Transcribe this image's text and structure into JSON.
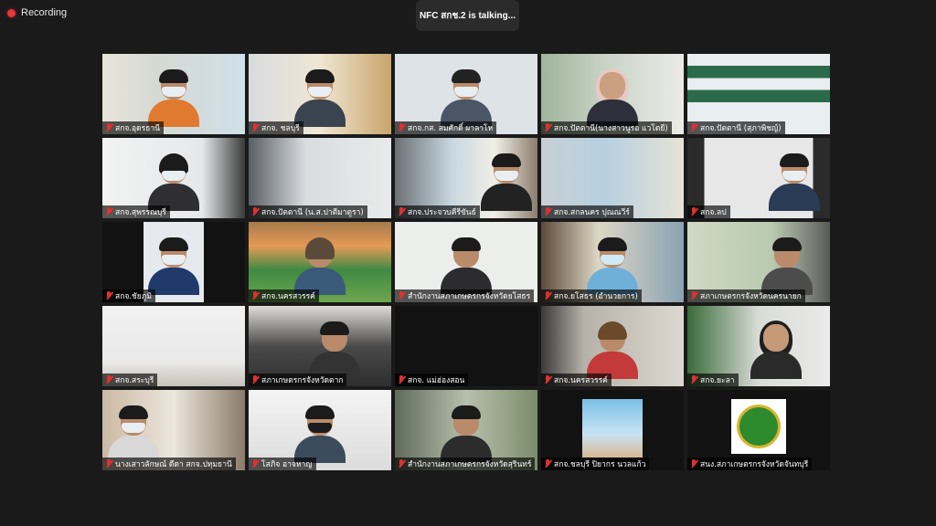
{
  "recording": {
    "label": "Recording"
  },
  "speaker": {
    "text": "NFC สกช.2 is  talking..."
  },
  "colors": {
    "background": "#1a1a1a",
    "muted_mic": "#e0312f",
    "recording_dot": "#e8363a"
  },
  "tiles": [
    {
      "name": "สกจ.อุดรธานี"
    },
    {
      "name": "สกจ. ชลบุรี"
    },
    {
      "name": "สกจ.กส. สมศักดิ์ ผาลาโห"
    },
    {
      "name": "สกจ.ปัตตานี(นางสาวนูรอ  แวโดยี)"
    },
    {
      "name": "สกจ.ปัตตานี (สุภาพิชญ์)"
    },
    {
      "name": "สกจ.สุพรรณบุรี"
    },
    {
      "name": "สกจ.ปัตตานี (น.ส.ปาตีมาตูรา)"
    },
    {
      "name": "สกจ.ประจวบคีรีขันธ์"
    },
    {
      "name": "สกจ.สกลนคร ปุณณวีร์"
    },
    {
      "name": "สกจ.ลป"
    },
    {
      "name": "สกจ.ชัยภูมิ"
    },
    {
      "name": "สกจ.นครสวรรค์"
    },
    {
      "name": "สำนักงานสภาเกษตรกรจังหวัดยโสธร"
    },
    {
      "name": "สกจ.ยโสธร (อำนวยการ)"
    },
    {
      "name": "สภาเกษตรกรจังหวัดนครนายก"
    },
    {
      "name": "สกจ.สระบุรี"
    },
    {
      "name": "สภาเกษตรกรจังหวัดตาก"
    },
    {
      "name": "สกจ. แม่ฮ่องสอน"
    },
    {
      "name": "สกจ.นครสวรรค์"
    },
    {
      "name": "สกจ.ยะลา"
    },
    {
      "name": "นางเสาวลักษณ์ ดีดา สกจ.ปทุมธานี"
    },
    {
      "name": "โสภิจ อาจหาญ"
    },
    {
      "name": "สำนักงานสภาเกษตรกรจังหวัดสุรินทร์"
    },
    {
      "name": "สกจ.ชลบุรี ปิยากร นวลแก้ว"
    },
    {
      "name": "สนง.สภาเกษตรกรจังหวัดจันทบุรี"
    }
  ]
}
